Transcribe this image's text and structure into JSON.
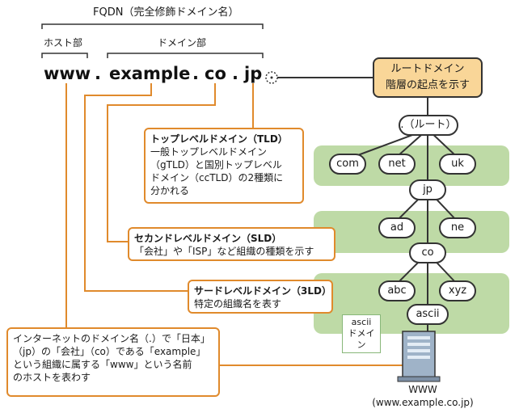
{
  "fqdn_label": "FQDN（完全修飾ドメイン名）",
  "host_label": "ホスト部",
  "domain_label": "ドメイン部",
  "fqdn_parts": [
    "www",
    ".",
    "example",
    ".",
    "co",
    ".",
    "jp"
  ],
  "root_box": {
    "line1": "ルートドメイン",
    "line2": "階層の起点を示す"
  },
  "tree_nodes": {
    "root": ".（ルート）",
    "com": "com",
    "net": "net",
    "uk": "uk",
    "jp": "jp",
    "ad": "ad",
    "ne": "ne",
    "co": "co",
    "abc": "abc",
    "xyz": "xyz",
    "ascii": "ascii"
  },
  "ascii_label": {
    "line1": "ascii",
    "line2": "ドメイン"
  },
  "server_caption": {
    "line1": "WWW",
    "line2": "(www.example.co.jp)"
  },
  "callouts": {
    "tld": {
      "title": "トップレベルドメイン（TLD）",
      "lines": [
        "一般トップレベルドメイン",
        "（gTLD）と国別トップレベル",
        "ドメイン（ccTLD）の2種類に",
        "分かれる"
      ]
    },
    "sld": {
      "title": "セカンドレベルドメイン（SLD）",
      "lines": [
        "「会社」や「ISP」など組織の種類を示す"
      ]
    },
    "third": {
      "title": "サードレベルドメイン（3LD）",
      "lines": [
        "特定の組織名を表す"
      ]
    },
    "host": {
      "lines": [
        "インターネットのドメイン名（.）で「日本」",
        "（jp）の「会社」（co）である「example」",
        "という組織に属する「www」という名前",
        "のホストを表わす"
      ]
    }
  },
  "colors": {
    "orange": "#e08a2c",
    "green_band": "#bedaa6",
    "root_fill": "#f9d698",
    "dark": "#333333"
  }
}
